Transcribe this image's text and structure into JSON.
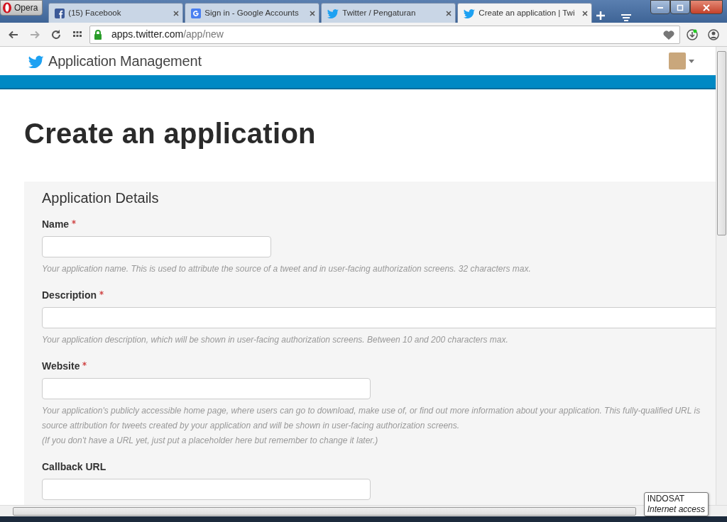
{
  "browser": {
    "menu_label": "Opera",
    "tabs": [
      {
        "title": "(15) Facebook",
        "selected": false
      },
      {
        "title": "Sign in - Google Accounts",
        "selected": false
      },
      {
        "title": "Twitter / Pengaturan",
        "selected": false
      },
      {
        "title": "Create an application | Twi",
        "selected": true
      }
    ],
    "url": {
      "host": "apps.twitter.com",
      "path": "/app/new"
    }
  },
  "header": {
    "title": "Application Management"
  },
  "page": {
    "heading": "Create an application",
    "section_title": "Application Details",
    "fields": [
      {
        "label": "Name",
        "required": true,
        "help": [
          "Your application name. This is used to attribute the source of a tweet and in user-facing authorization screens. 32 characters max."
        ]
      },
      {
        "label": "Description",
        "required": true,
        "help": [
          "Your application description, which will be shown in user-facing authorization screens. Between 10 and 200 characters max."
        ]
      },
      {
        "label": "Website",
        "required": true,
        "help": [
          "Your application's publicly accessible home page, where users can go to download, make use of, or find out more information about your application. This fully-qualified URL is",
          "source attribution for tweets created by your application and will be shown in user-facing authorization screens.",
          "(If you don't have a URL yet, just put a placeholder here but remember to change it later.)"
        ]
      },
      {
        "label": "Callback URL",
        "required": false
      }
    ]
  },
  "tooltip": {
    "title": "INDOSAT",
    "subtitle": "Internet access"
  }
}
